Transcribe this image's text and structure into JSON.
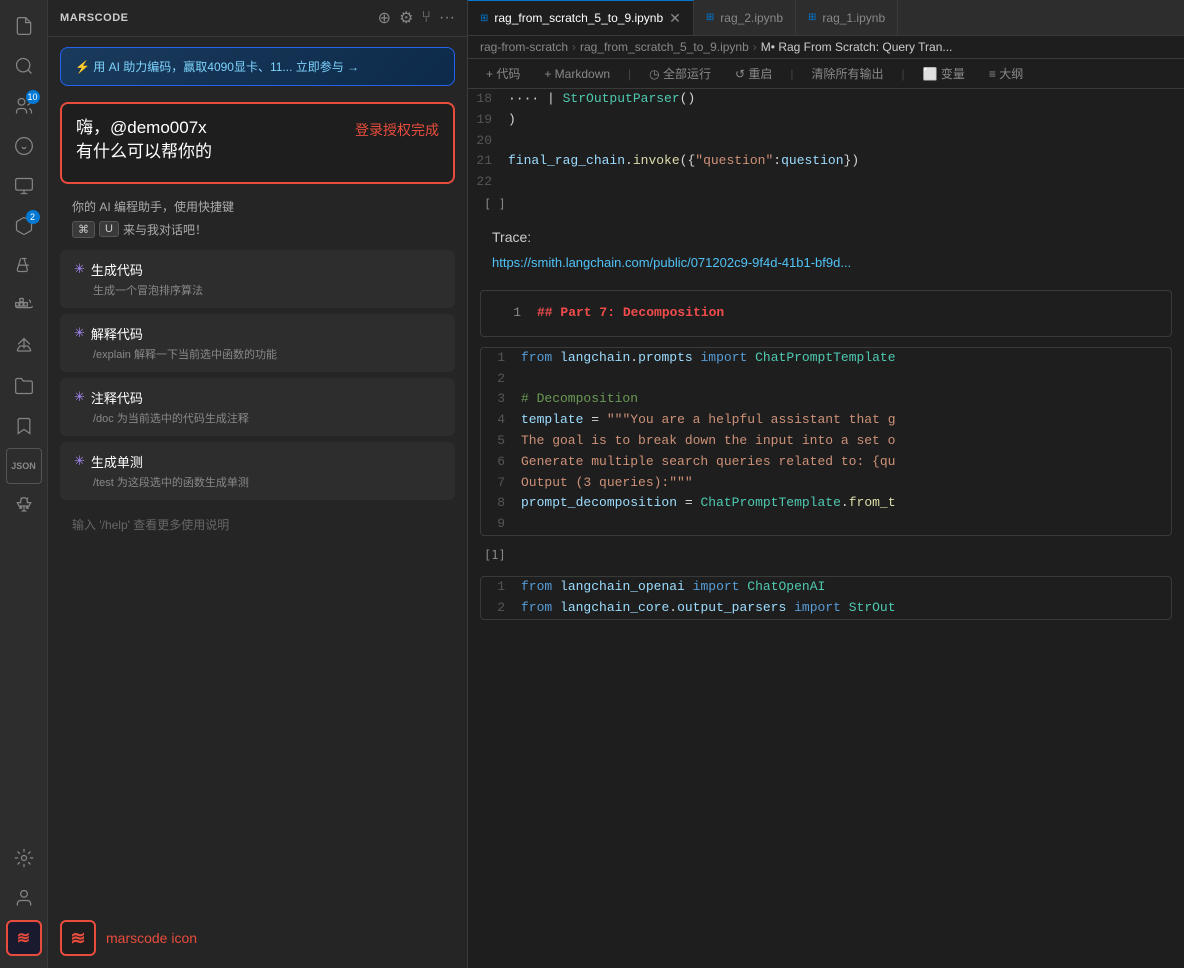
{
  "sidebar": {
    "title": "MARSCODE",
    "promo": {
      "text": "⚡ 用 AI 助力编码，赢取4090显卡、11... 立即参与 →"
    },
    "greeting": {
      "main_line1": "嗨，@demo007x",
      "main_line2": "有什么可以帮你的",
      "auth_text": "登录授权完成"
    },
    "subtitle": "你的 AI 编程助手，使用快捷键",
    "shortcut": "来与我对话吧！",
    "features": [
      {
        "title": "✳ 生成代码",
        "desc": "生成一个冒泡排序算法"
      },
      {
        "title": "✳ 解释代码",
        "desc": "/explain 解释一下当前选中函数的功能"
      },
      {
        "title": "✳ 注释代码",
        "desc": "/doc 为当前选中的代码生成注释"
      },
      {
        "title": "✳ 生成单测",
        "desc": "/test 为这段选中的函数生成单测"
      }
    ],
    "help_text": "输入 '/help' 查看更多使用说明",
    "marscode_label": "marscode icon"
  },
  "tabs": [
    {
      "label": "rag_from_scratch_5_to_9.ipynb",
      "active": true,
      "closeable": true
    },
    {
      "label": "rag_2.ipynb",
      "active": false,
      "closeable": false
    },
    {
      "label": "rag_1.ipynb",
      "active": false,
      "closeable": false
    }
  ],
  "breadcrumb": [
    "rag-from-scratch",
    "rag_from_scratch_5_to_9.ipynb",
    "M• Rag From Scratch: Query Tran..."
  ],
  "toolbar": {
    "add_code": "+ 代码",
    "add_markdown": "+ Markdown",
    "run_all": "◷ 全部运行",
    "restart": "↺ 重启",
    "clear_output": "清除所有输出",
    "variables": "⬜ 变量",
    "outline": "≡ 大纲"
  },
  "code_lines_top": [
    {
      "num": "18",
      "content": "    | StrOutputParser()"
    },
    {
      "num": "19",
      "content": ")"
    },
    {
      "num": "20",
      "content": ""
    },
    {
      "num": "21",
      "content": "final_rag_chain.invoke({\"question\":question})"
    },
    {
      "num": "22",
      "content": ""
    }
  ],
  "cell_output_top": "[ ]",
  "trace_label": "Trace:",
  "trace_url": "https://smith.langchain.com/public/071202c9-9f4d-41b1-bf9d...",
  "part7_heading": "## Part 7: Decomposition",
  "code_lines_mid": [
    {
      "num": "1",
      "content": "from langchain.prompts import ChatPromptTemplate"
    },
    {
      "num": "2",
      "content": ""
    },
    {
      "num": "3",
      "content": "# Decomposition"
    },
    {
      "num": "4",
      "content": "template = \"\"\"You are a helpful assistant that g"
    },
    {
      "num": "5",
      "content": "The goal is to break down the input into a set o"
    },
    {
      "num": "6",
      "content": "Generate multiple search queries related to: {qu"
    },
    {
      "num": "7",
      "content": "Output (3 queries):\"\"\""
    },
    {
      "num": "8",
      "content": "prompt_decomposition = ChatPromptTemplate.from_t"
    },
    {
      "num": "9",
      "content": ""
    }
  ],
  "cell_output_mid": "[1]",
  "code_lines_bot": [
    {
      "num": "1",
      "content": "from langchain_openai import ChatOpenAI"
    },
    {
      "num": "2",
      "content": "from langchain_core.output_parsers import StrOut"
    }
  ],
  "activity_icons": [
    {
      "name": "file-icon",
      "symbol": "🗋",
      "active": false
    },
    {
      "name": "search-icon",
      "symbol": "🔍",
      "active": false
    },
    {
      "name": "ai-icon",
      "symbol": "👥",
      "active": false,
      "badge": "10"
    },
    {
      "name": "debug-icon",
      "symbol": "🐛",
      "active": false
    },
    {
      "name": "monitor-icon",
      "symbol": "🖥",
      "active": false
    },
    {
      "name": "extensions-icon",
      "symbol": "⬡",
      "active": false,
      "badge": "2"
    },
    {
      "name": "flask-icon",
      "symbol": "⚗",
      "active": false
    },
    {
      "name": "docker-icon",
      "symbol": "⬡",
      "active": false
    },
    {
      "name": "ship-icon",
      "symbol": "🚢",
      "active": false
    },
    {
      "name": "folder-icon",
      "symbol": "📁",
      "active": false
    },
    {
      "name": "bookmark-icon",
      "symbol": "🔖",
      "active": false
    },
    {
      "name": "json-icon",
      "symbol": "json",
      "active": false
    },
    {
      "name": "bug2-icon",
      "symbol": "🦟",
      "active": false
    },
    {
      "name": "settings-icon",
      "symbol": "⚙",
      "active": false
    },
    {
      "name": "user-icon",
      "symbol": "👤",
      "active": false
    },
    {
      "name": "marscode-bottom-icon",
      "symbol": "〜",
      "active": true
    }
  ]
}
